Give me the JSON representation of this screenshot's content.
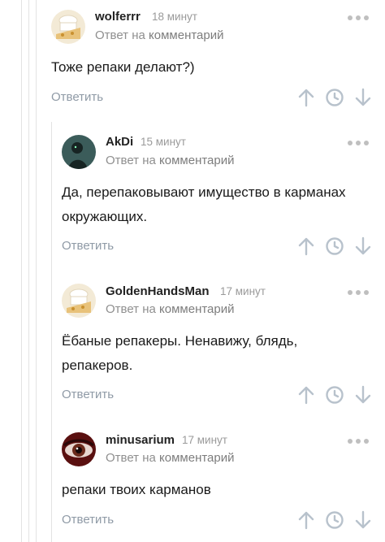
{
  "reply_label": "Ответить",
  "reply_to": {
    "prefix": "Ответ на",
    "link": "комментарий"
  },
  "comments": [
    {
      "author": "wolferrr",
      "time": "18 минут",
      "text": "Тоже репаки делают?)",
      "avatar": "baked-goods-avatar"
    },
    {
      "author": "AkDi",
      "time": "15 минут",
      "text_lines": [
        "Да, перепаковывают имущество в карманах",
        "окружающих."
      ],
      "avatar": "dark-figure-avatar"
    },
    {
      "author": "GoldenHandsMan",
      "time": "17 минут",
      "text_lines": [
        "Ёбаные репакеры. Ненавижу, блядь,",
        "репакеров."
      ],
      "avatar": "baked-goods-avatar"
    },
    {
      "author": "minusarium",
      "time": "17 минут",
      "text": "репаки твоих карманов",
      "avatar": "eye-avatar"
    }
  ],
  "colors": {
    "icon": "#b8c2cc",
    "reply": "#8f9aa6",
    "guide": "#e3e3e3"
  }
}
